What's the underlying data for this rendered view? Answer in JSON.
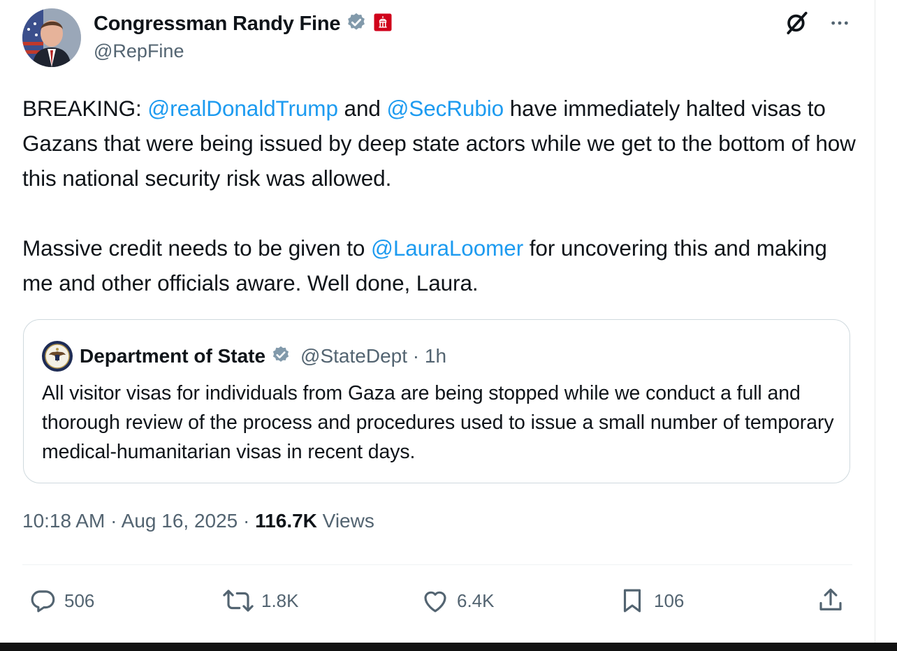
{
  "author": {
    "display_name": "Congressman Randy Fine",
    "handle": "@RepFine",
    "verified_icon": "verified-badge-icon",
    "affiliation_icon": "capitol-badge-icon"
  },
  "tweet": {
    "paragraph1": {
      "t1": "BREAKING: ",
      "m1": "@realDonaldTrump",
      "t2": " and ",
      "m2": "@SecRubio",
      "t3": " have immediately halted visas to Gazans that were being issued by deep state actors while we get to the bottom of how this national security risk was allowed."
    },
    "paragraph2": {
      "t1": "Massive credit needs to be given to ",
      "m1": "@LauraLoomer",
      "t2": " for uncovering this and making me and other officials aware.  Well done, Laura."
    }
  },
  "quote": {
    "display_name": "Department of State",
    "handle": "@StateDept",
    "separator": "·",
    "time": "1h",
    "text": "All visitor visas for individuals from Gaza are being stopped while we conduct a full and thorough review of the process and procedures used to issue a small number of temporary medical-humanitarian visas in recent days."
  },
  "meta": {
    "time": "10:18 AM",
    "sep1": " · ",
    "date": "Aug 16, 2025",
    "sep2": " · ",
    "views_count": "116.7K",
    "views_label": " Views"
  },
  "actions": {
    "replies": "506",
    "reposts": "1.8K",
    "likes": "6.4K",
    "bookmarks": "106"
  },
  "colors": {
    "link": "#1d9bf0",
    "secondary_text": "#536471",
    "verified_badge": "#829aab",
    "affiliation_badge": "#d0021b",
    "border": "#cfd9de"
  }
}
